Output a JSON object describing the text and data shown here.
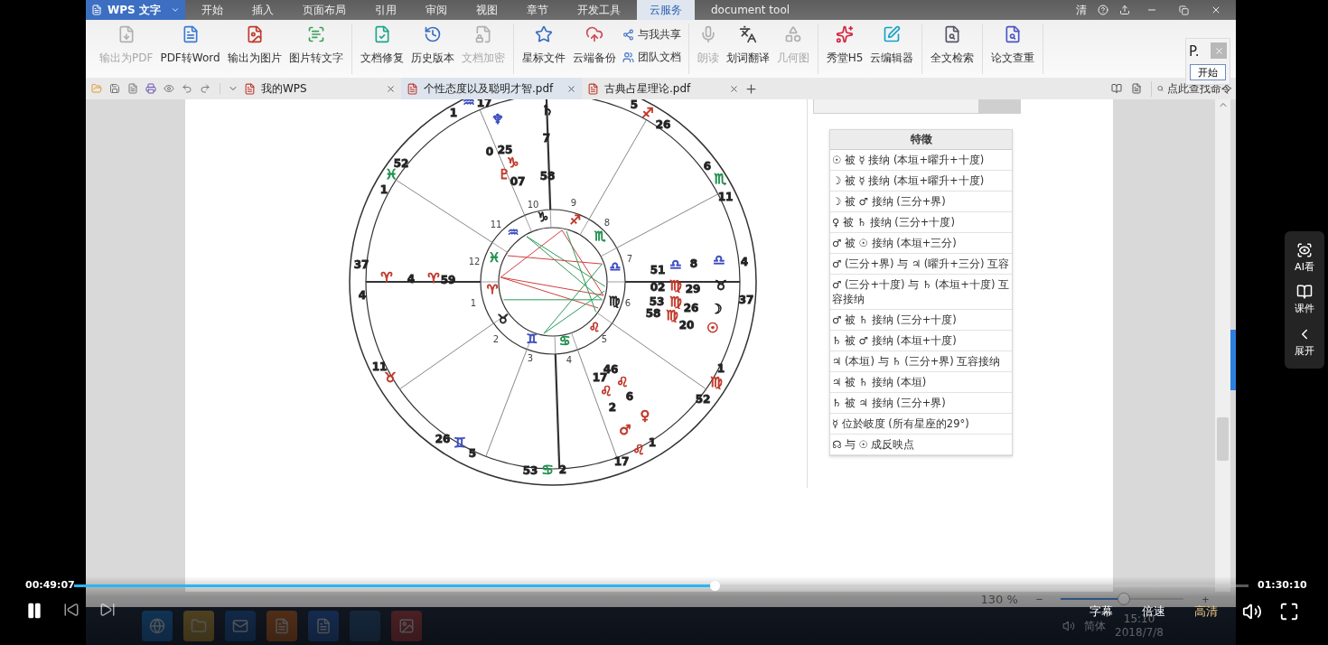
{
  "app": {
    "brand": "WPS 文字",
    "menu": [
      {
        "label": "开始",
        "selected": false
      },
      {
        "label": "插入",
        "selected": false
      },
      {
        "label": "页面布局",
        "selected": false
      },
      {
        "label": "引用",
        "selected": false
      },
      {
        "label": "审阅",
        "selected": false
      },
      {
        "label": "视图",
        "selected": false
      },
      {
        "label": "章节",
        "selected": false
      },
      {
        "label": "开发工具",
        "selected": false
      },
      {
        "label": "云服务",
        "selected": true
      },
      {
        "label": "document tool",
        "selected": false
      }
    ],
    "user": "清",
    "ribbon": [
      {
        "items": [
          {
            "kind": "large",
            "label": "输出为PDF",
            "disabled": true
          },
          {
            "kind": "large",
            "label": "PDF转Word",
            "disabled": false
          },
          {
            "kind": "large",
            "label": "输出为图片",
            "disabled": false
          },
          {
            "kind": "large",
            "label": "图片转文字",
            "disabled": false
          }
        ]
      },
      {
        "items": [
          {
            "kind": "large",
            "label": "文档修复",
            "disabled": false
          },
          {
            "kind": "large",
            "label": "历史版本",
            "disabled": false
          },
          {
            "kind": "large",
            "label": "文档加密",
            "disabled": true
          }
        ]
      },
      {
        "items": [
          {
            "kind": "large",
            "label": "星标文件",
            "disabled": false
          },
          {
            "kind": "large",
            "label": "云端备份",
            "disabled": false
          },
          {
            "kind": "small",
            "label": "与我共享",
            "disabled": false
          },
          {
            "kind": "small",
            "label": "团队文档",
            "disabled": false
          }
        ]
      },
      {
        "items": [
          {
            "kind": "large",
            "label": "朗读",
            "disabled": true
          },
          {
            "kind": "large",
            "label": "划词翻译",
            "disabled": false
          },
          {
            "kind": "large",
            "label": "几何图",
            "disabled": true
          }
        ]
      },
      {
        "items": [
          {
            "kind": "large",
            "label": "秀堂H5",
            "disabled": false
          },
          {
            "kind": "large",
            "label": "云编辑器",
            "disabled": false
          }
        ]
      },
      {
        "items": [
          {
            "kind": "large",
            "label": "全文检索",
            "disabled": false
          }
        ]
      },
      {
        "items": [
          {
            "kind": "large",
            "label": "论文查重",
            "disabled": false
          }
        ]
      }
    ],
    "tabs": [
      {
        "label": "我的WPS",
        "selected": false
      },
      {
        "label": "个性态度以及聪明才智.pdf",
        "selected": true
      },
      {
        "label": "古典占星理论.pdf",
        "selected": false
      }
    ],
    "command_search": {
      "placeholder": "点此查找命令"
    },
    "popup": {
      "title": "P.",
      "button": "开始"
    }
  },
  "document": {
    "chart": {
      "labels": [
        {
          "text": "♒",
          "color": "#3b4cc0"
        },
        {
          "text": "17",
          "color": "#222222"
        },
        {
          "text": "1",
          "color": "#222222"
        },
        {
          "text": "♆",
          "color": "#3b4cc0"
        },
        {
          "text": "♄",
          "color": "#222222"
        },
        {
          "text": "7",
          "color": "#222222"
        },
        {
          "text": "0",
          "color": "#222222"
        },
        {
          "text": "25",
          "color": "#222222"
        },
        {
          "text": "♑",
          "color": "#c0392b"
        },
        {
          "text": "♇",
          "color": "#c0392b"
        },
        {
          "text": "07",
          "color": "#222222"
        },
        {
          "text": "58",
          "color": "#222222"
        },
        {
          "text": "5",
          "color": "#222222"
        },
        {
          "text": "♐",
          "color": "#c0392b"
        },
        {
          "text": "26",
          "color": "#222222"
        },
        {
          "text": "6",
          "color": "#222222"
        },
        {
          "text": "♏",
          "color": "#1f8f4e"
        },
        {
          "text": "11",
          "color": "#222222"
        },
        {
          "text": "52",
          "color": "#222222"
        },
        {
          "text": "♓",
          "color": "#1f8f4e"
        },
        {
          "text": "1",
          "color": "#222222"
        },
        {
          "text": "37",
          "color": "#222222"
        },
        {
          "text": "♈",
          "color": "#c0392b"
        },
        {
          "text": "4",
          "color": "#222222"
        },
        {
          "text": "4",
          "color": "#222222"
        },
        {
          "text": "♈",
          "color": "#c0392b"
        },
        {
          "text": "59",
          "color": "#222222"
        },
        {
          "text": "51",
          "color": "#222222"
        },
        {
          "text": "♎",
          "color": "#3b4cc0"
        },
        {
          "text": "8",
          "color": "#222222"
        },
        {
          "text": "♎",
          "color": "#3b4cc0"
        },
        {
          "text": "4",
          "color": "#222222"
        },
        {
          "text": "02",
          "color": "#222222"
        },
        {
          "text": "♍",
          "color": "#c0392b"
        },
        {
          "text": "29",
          "color": "#222222"
        },
        {
          "text": "♉",
          "color": "#222222"
        },
        {
          "text": "53",
          "color": "#222222"
        },
        {
          "text": "♍",
          "color": "#c0392b"
        },
        {
          "text": "26",
          "color": "#222222"
        },
        {
          "text": "☽",
          "color": "#222222"
        },
        {
          "text": "37",
          "color": "#222222"
        },
        {
          "text": "58",
          "color": "#222222"
        },
        {
          "text": "♍",
          "color": "#c0392b"
        },
        {
          "text": "20",
          "color": "#222222"
        },
        {
          "text": "☉",
          "color": "#c0392b"
        },
        {
          "text": "11",
          "color": "#222222"
        },
        {
          "text": "♉",
          "color": "#c0392b"
        },
        {
          "text": "26",
          "color": "#222222"
        },
        {
          "text": "♊",
          "color": "#3b4cc0"
        },
        {
          "text": "5",
          "color": "#222222"
        },
        {
          "text": "53",
          "color": "#222222"
        },
        {
          "text": "♋",
          "color": "#1f8f4e"
        },
        {
          "text": "2",
          "color": "#222222"
        },
        {
          "text": "46",
          "color": "#222222"
        },
        {
          "text": "17",
          "color": "#222222"
        },
        {
          "text": "♌",
          "color": "#c0392b"
        },
        {
          "text": "♌",
          "color": "#c0392b"
        },
        {
          "text": "6",
          "color": "#222222"
        },
        {
          "text": "2",
          "color": "#222222"
        },
        {
          "text": "♀",
          "color": "#c0392b"
        },
        {
          "text": "♂",
          "color": "#c0392b"
        },
        {
          "text": "1",
          "color": "#222222"
        },
        {
          "text": "17",
          "color": "#222222"
        },
        {
          "text": "♌",
          "color": "#c0392b"
        },
        {
          "text": "1",
          "color": "#222222"
        },
        {
          "text": "♍",
          "color": "#c0392b"
        },
        {
          "text": "52",
          "color": "#222222"
        }
      ],
      "house_numbers": [
        "1",
        "2",
        "3",
        "4",
        "5",
        "6",
        "7",
        "8",
        "9",
        "10",
        "11",
        "12"
      ],
      "wheel_signs": [
        {
          "text": "♑",
          "color": "#222222"
        },
        {
          "text": "♐",
          "color": "#c0392b"
        },
        {
          "text": "♏",
          "color": "#1f8f4e"
        },
        {
          "text": "♎",
          "color": "#3b4cc0"
        },
        {
          "text": "♍",
          "color": "#222222"
        },
        {
          "text": "♌",
          "color": "#c0392b"
        },
        {
          "text": "♋",
          "color": "#1f8f4e"
        },
        {
          "text": "♊",
          "color": "#3b4cc0"
        },
        {
          "text": "♉",
          "color": "#222222"
        },
        {
          "text": "♈",
          "color": "#c0392b"
        },
        {
          "text": "♓",
          "color": "#1f8f4e"
        },
        {
          "text": "♒",
          "color": "#3b4cc0"
        }
      ]
    },
    "table": {
      "header": "特徵",
      "rows": [
        "☉ 被 ☿ 接纳 (本垣+曜升+十度)",
        "☽ 被 ☿ 接纳 (本垣+曜升+十度)",
        "☽ 被 ♂ 接纳 (三分+界)",
        "♀ 被 ♄ 接纳 (三分+十度)",
        "♂ 被 ☉ 接纳 (本垣+三分)",
        "♂ (三分+界) 与 ♃ (曜升+三分) 互容",
        "♂ (三分+十度) 与 ♄ (本垣+十度) 互容接纳",
        "♂ 被 ♄ 接纳 (三分+十度)",
        "♄ 被 ♂ 接纳 (本垣+十度)",
        "♃ (本垣) 与 ♄ (三分+界) 互容接纳",
        "♃ 被 ♄ 接纳 (本垣)",
        "♄ 被 ♃ 接纳 (三分+界)",
        "☿ 位於岐度 (所有星座的29°)",
        "☊ 与 ☉ 成反映点"
      ]
    }
  },
  "status_bar": {
    "zoom": "130 %",
    "zoom_out": "−",
    "zoom_in": "+",
    "zoom_slider": {
      "level": 0.51
    }
  },
  "taskbar": {
    "language": "简体",
    "time": "15:10",
    "date": "2018/7/8"
  },
  "player": {
    "elapsed": "00:49:07",
    "total": "01:30:10",
    "progress": {
      "level": 0.545
    },
    "playing": true,
    "options": [
      {
        "label": "字幕",
        "selected": false
      },
      {
        "label": "倍速",
        "selected": false
      },
      {
        "label": "高清",
        "selected": true
      }
    ]
  },
  "side_panel": {
    "items": [
      {
        "label": "AI看"
      },
      {
        "label": "课件"
      },
      {
        "label": "展开"
      }
    ]
  }
}
